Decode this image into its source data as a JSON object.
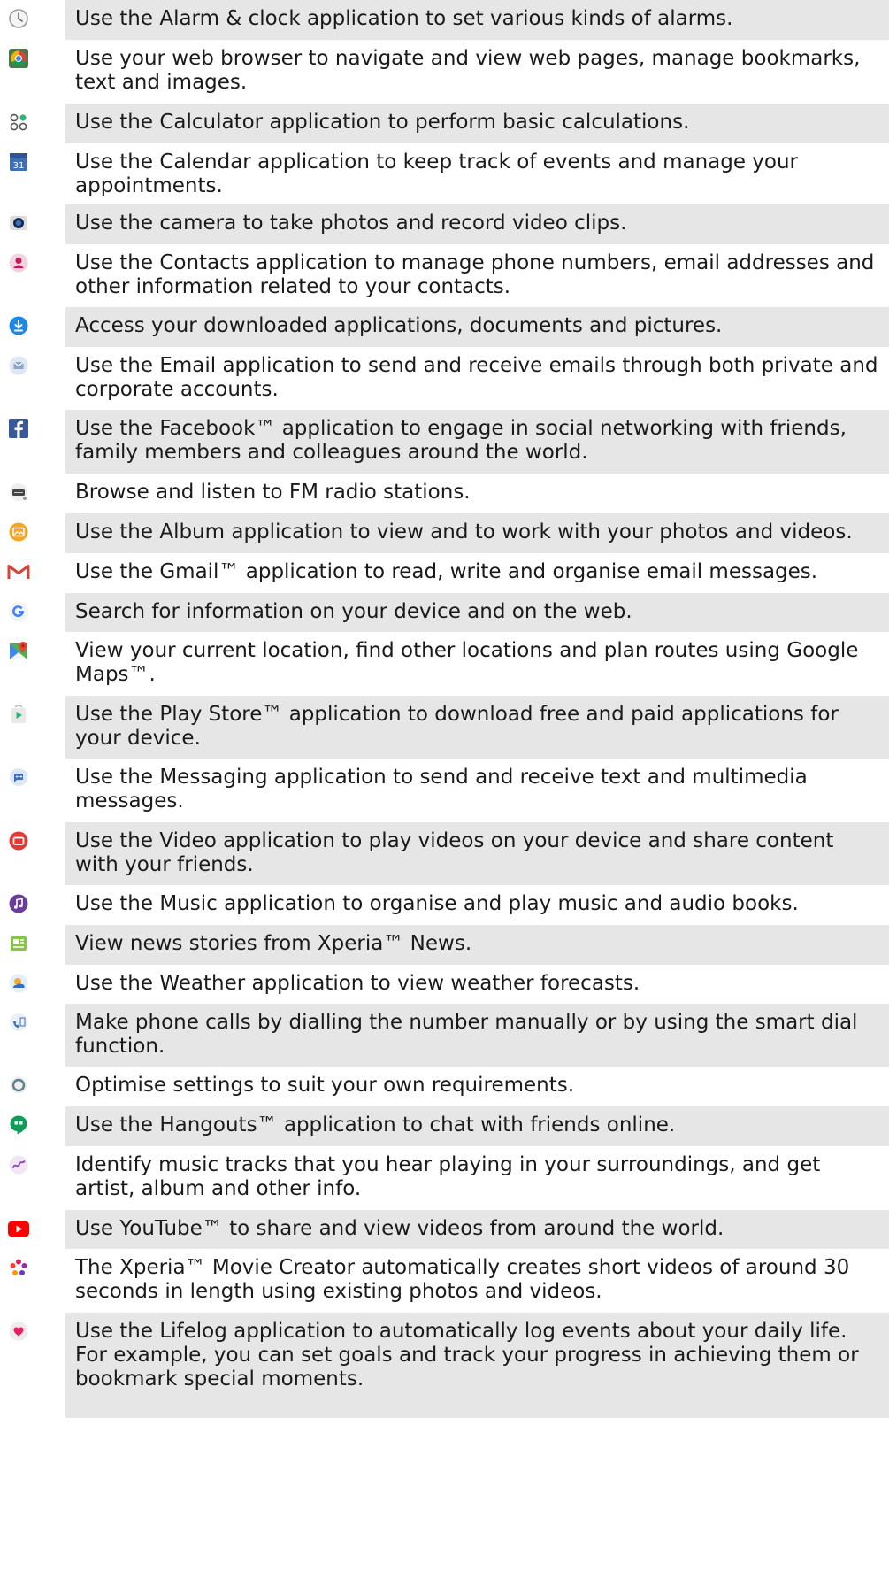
{
  "rows": [
    {
      "icon": "alarm-clock-icon",
      "text": "Use the Alarm & clock application to set various kinds of alarms."
    },
    {
      "icon": "browser-icon",
      "text": "Use your web browser to navigate and view web pages, manage bookmarks, text and images."
    },
    {
      "icon": "calculator-icon",
      "text": "Use the Calculator application to perform basic calculations."
    },
    {
      "icon": "calendar-icon",
      "text": "Use the Calendar application to keep track of events and manage your appointments.",
      "icon_text": "31"
    },
    {
      "icon": "camera-icon",
      "text": "Use the camera to take photos and record video clips."
    },
    {
      "icon": "contacts-icon",
      "text": "Use the Contacts application to manage phone numbers, email addresses and other information related to your contacts."
    },
    {
      "icon": "download-icon",
      "text": "Access your downloaded applications, documents and pictures."
    },
    {
      "icon": "email-icon",
      "text": "Use the Email application to send and receive emails through both private and corporate accounts."
    },
    {
      "icon": "facebook-icon",
      "text": "Use the Facebook™ application to engage in social networking with friends, family members and colleagues around the world."
    },
    {
      "icon": "fm-radio-icon",
      "text": "Browse and listen to FM radio stations."
    },
    {
      "icon": "album-icon",
      "text": "Use the Album application to view and to work with your photos and videos."
    },
    {
      "icon": "gmail-icon",
      "text": "Use the Gmail™ application to read, write and organise email messages."
    },
    {
      "icon": "google-icon",
      "text": "Search for information on your device and on the web."
    },
    {
      "icon": "maps-icon",
      "text": "View your current location, find other locations and plan routes using Google Maps™."
    },
    {
      "icon": "play-store-icon",
      "text": "Use the Play Store™ application to download free and paid applications for your device."
    },
    {
      "icon": "messaging-icon",
      "text": "Use the Messaging application to send and receive text and multimedia messages."
    },
    {
      "icon": "video-icon",
      "text": "Use the Video application to play videos on your device and share content with your friends."
    },
    {
      "icon": "music-icon",
      "text": "Use the Music application to organise and play music and audio books."
    },
    {
      "icon": "news-icon",
      "text": "View news stories from Xperia™ News."
    },
    {
      "icon": "weather-icon",
      "text": "Use the Weather application to view weather forecasts."
    },
    {
      "icon": "phone-icon",
      "text": "Make phone calls by dialling the number manually or by using the smart dial function."
    },
    {
      "icon": "settings-icon",
      "text": "Optimise settings to suit your own requirements."
    },
    {
      "icon": "hangouts-icon",
      "text": "Use the Hangouts™ application to chat with friends online."
    },
    {
      "icon": "music-recognition-icon",
      "text": "Identify music tracks that you hear playing in your surroundings, and get artist, album and other info."
    },
    {
      "icon": "youtube-icon",
      "text": "Use YouTube™ to share and view videos from around the world."
    },
    {
      "icon": "movie-creator-icon",
      "text": "The Xperia™ Movie Creator automatically creates short videos of around 30 seconds in length using existing photos and videos."
    },
    {
      "icon": "lifelog-icon",
      "text": "Use the Lifelog application to automatically log events about your daily life. For example, you can set goals and track your progress in achieving them or bookmark special moments."
    }
  ],
  "colors": {
    "row_shade": "#e6e6e6",
    "text": "#1a1a1a",
    "facebook": "#3b5998",
    "gmail": "#d44638",
    "youtube": "#ff0000",
    "music": "#6a3d9a",
    "hangouts": "#0f9d58",
    "download": "#1e88e5",
    "album": "#f5a623"
  }
}
